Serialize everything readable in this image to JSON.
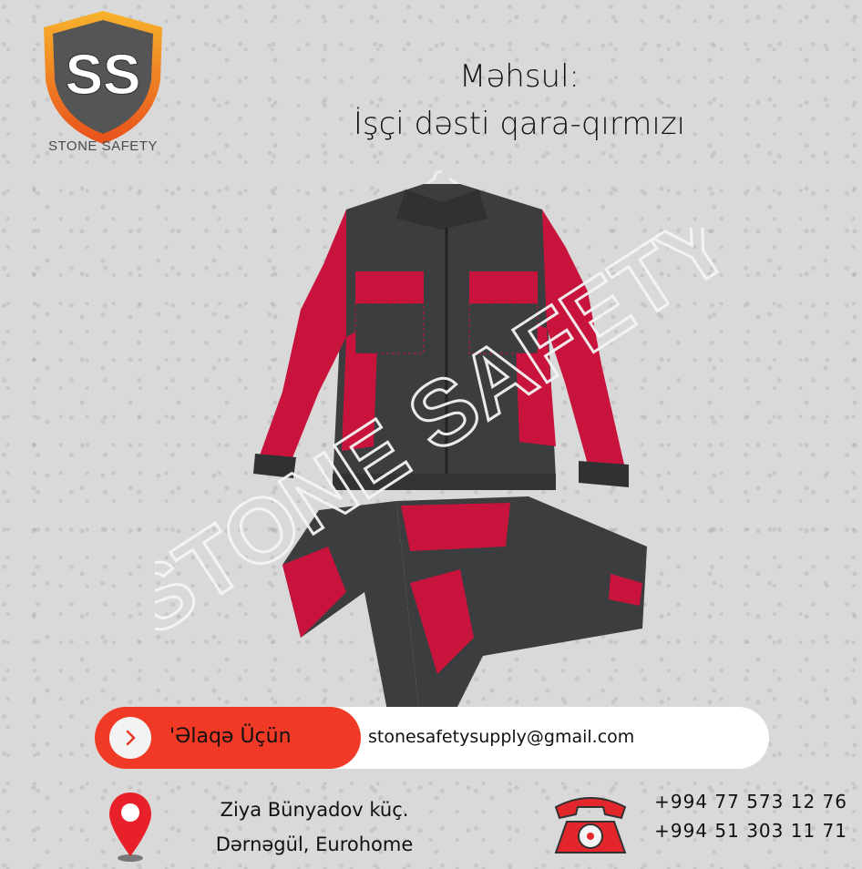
{
  "brand": {
    "name": "STONE SAFETY",
    "monogram": "SS",
    "icon": "shield-logo"
  },
  "title": {
    "line1": "Məhsul:",
    "line2": "İşçi dəsti qara-qırmızı"
  },
  "product": {
    "image": "red-black-work-suit",
    "watermark": "STONE SAFETY"
  },
  "contact": {
    "label": "'Əlaqə Üçün",
    "email": "stonesafetysupply@gmail.com",
    "arrow_icon": "chevron-right-icon"
  },
  "address": {
    "line1": "Ziya Bünyadov küç.",
    "line2": "Dərnəgül, Eurohome",
    "icon": "location-pin-icon"
  },
  "phones": {
    "phone1": "+994 77 573 12 76",
    "phone2": "+994 51 303 11 71",
    "icon": "telephone-icon"
  },
  "colors": {
    "accent_red": "#f03a25",
    "suit_red": "#c8143c",
    "suit_gray": "#3b3d3f"
  }
}
